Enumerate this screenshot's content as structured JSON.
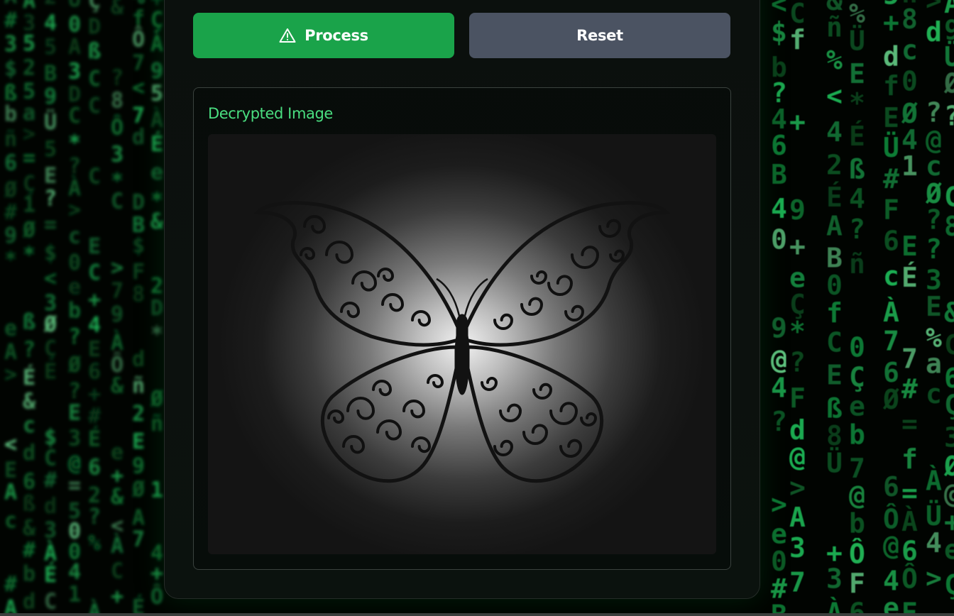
{
  "actions": {
    "process_label": "Process",
    "process_icon": "warning-triangle-icon",
    "reset_label": "Reset"
  },
  "result": {
    "title": "Decrypted Image",
    "image_subject": "butterfly"
  },
  "background": {
    "style": "matrix-rain",
    "glyph_color": "#22c55e"
  },
  "colors": {
    "process_button": "#1aa34a",
    "reset_button": "#4b5362",
    "title_accent": "#4ade80",
    "panel": "#0c110e"
  }
}
